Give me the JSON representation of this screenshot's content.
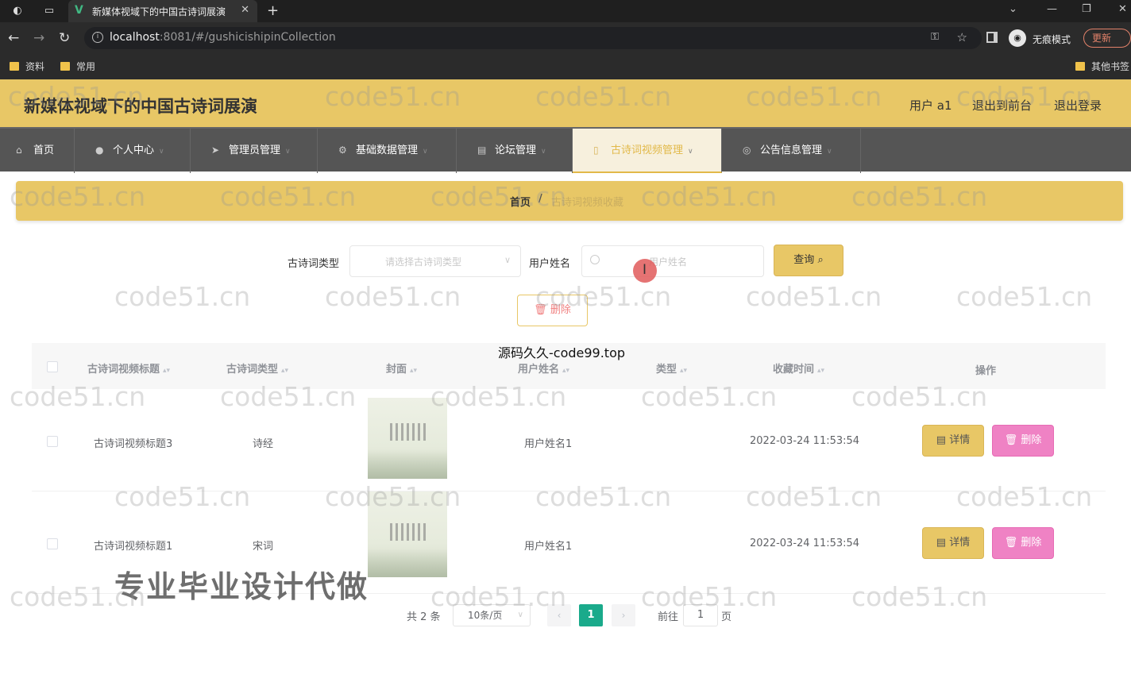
{
  "browser": {
    "tab_title": "新媒体视域下的中国古诗词展演",
    "url_host": "localhost",
    "url_rest": ":8081/#/gushicishipinCollection",
    "incognito_label": "无痕模式",
    "update_label": "更新",
    "bookmarks": [
      "资料",
      "常用"
    ],
    "other_bookmarks": "其他书签"
  },
  "header": {
    "title": "新媒体视域下的中国古诗词展演",
    "user": "用户 a1",
    "to_front": "退出到前台",
    "logout": "退出登录"
  },
  "nav": {
    "items": [
      "首页",
      "个人中心",
      "管理员管理",
      "基础数据管理",
      "论坛管理",
      "古诗词视频管理",
      "公告信息管理"
    ],
    "active_index": 5
  },
  "breadcrumb": {
    "home": "首页",
    "separator": "/",
    "current": "古诗词视频收藏"
  },
  "search": {
    "type_label": "古诗词类型",
    "type_placeholder": "请选择古诗词类型",
    "user_label": "用户姓名",
    "user_placeholder": "用户姓名",
    "query_label": "查询"
  },
  "toolbar": {
    "delete_label": "删除"
  },
  "overlays": {
    "source_text": "源码久久-code99.top",
    "promo_text": "专业毕业设计代做",
    "watermark": "code51.cn"
  },
  "table": {
    "columns": [
      "古诗词视频标题",
      "古诗词类型",
      "封面",
      "用户姓名",
      "类型",
      "收藏时间",
      "操作"
    ],
    "rows": [
      {
        "title": "古诗词视频标题3",
        "type": "诗经",
        "user": "用户姓名1",
        "kind": "",
        "time": "2022-03-24 11:53:54"
      },
      {
        "title": "古诗词视频标题1",
        "type": "宋词",
        "user": "用户姓名1",
        "kind": "",
        "time": "2022-03-24 11:53:54"
      }
    ],
    "detail_label": "详情",
    "delete_label": "删除"
  },
  "pagination": {
    "total": "共 2 条",
    "page_size": "10条/页",
    "current_page": "1",
    "goto_label": "前往",
    "goto_value": "1",
    "page_unit": "页"
  },
  "colors": {
    "primary": "#e8c766",
    "nav_bg": "#555555",
    "delete_pink": "#ef82c4",
    "page_active": "#1aaa8b"
  }
}
